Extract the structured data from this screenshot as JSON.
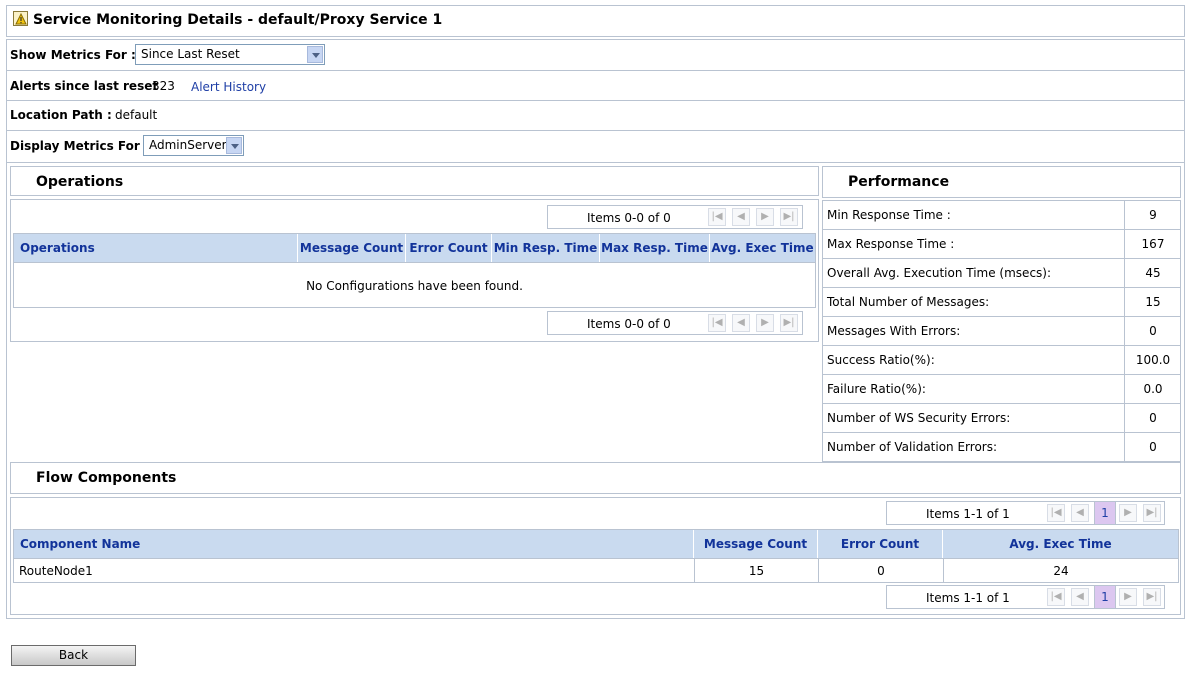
{
  "title": "Service Monitoring Details - default/Proxy Service 1",
  "show_metrics": {
    "label": "Show Metrics For :",
    "value": "Since Last Reset"
  },
  "alerts": {
    "label": "Alerts since last reset",
    "count": "323",
    "link": "Alert History"
  },
  "location": {
    "label": "Location Path :",
    "value": "default"
  },
  "display_metrics": {
    "label": "Display Metrics For :",
    "value": "AdminServer"
  },
  "operations": {
    "title": "Operations",
    "pager_text": "Items 0-0 of 0",
    "columns": [
      "Operations",
      "Message Count",
      "Error Count",
      "Min Resp. Time",
      "Max Resp. Time",
      "Avg. Exec Time"
    ],
    "empty_message": "No Configurations have been found."
  },
  "performance": {
    "title": "Performance",
    "rows": [
      {
        "label": "Min Response Time :",
        "value": "9"
      },
      {
        "label": "Max Response Time :",
        "value": "167"
      },
      {
        "label": "Overall Avg. Execution Time (msecs):",
        "value": "45"
      },
      {
        "label": "Total Number of Messages:",
        "value": "15"
      },
      {
        "label": "Messages With Errors:",
        "value": "0"
      },
      {
        "label": "Success Ratio(%):",
        "value": "100.0"
      },
      {
        "label": "Failure Ratio(%):",
        "value": "0.0"
      },
      {
        "label": "Number of WS Security Errors:",
        "value": "0"
      },
      {
        "label": "Number of Validation Errors:",
        "value": "0"
      }
    ]
  },
  "flow": {
    "title": "Flow Components",
    "pager_text": "Items 1-1 of 1",
    "page": "1",
    "columns": [
      "Component Name",
      "Message Count",
      "Error Count",
      "Avg. Exec Time"
    ],
    "rows": [
      {
        "name": "RouteNode1",
        "message_count": "15",
        "error_count": "0",
        "avg_exec": "24"
      }
    ]
  },
  "back_label": "Back",
  "colors": {
    "header_bg": "#c9daef",
    "header_text": "#12339a",
    "border": "#b9c3d1",
    "page_highlight": "#dcc7f0"
  }
}
